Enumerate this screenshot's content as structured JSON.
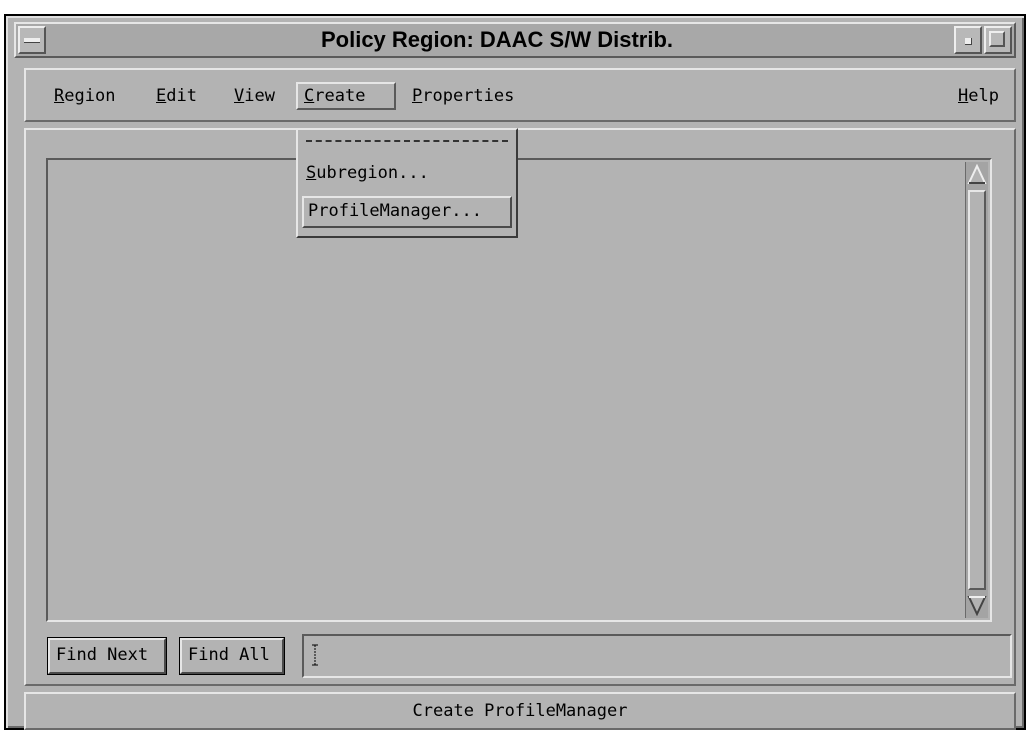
{
  "window": {
    "title": "Policy Region: DAAC S/W Distrib."
  },
  "menubar": {
    "items": [
      {
        "mnemonic": "R",
        "rest": "egion"
      },
      {
        "mnemonic": "E",
        "rest": "dit"
      },
      {
        "mnemonic": "V",
        "rest": "iew"
      },
      {
        "mnemonic": "C",
        "rest": "reate"
      },
      {
        "mnemonic": "P",
        "rest": "roperties"
      }
    ],
    "help": {
      "mnemonic": "H",
      "rest": "elp"
    }
  },
  "create_menu": {
    "items": [
      {
        "mnemonic": "S",
        "rest": "ubregion..."
      },
      {
        "mnemonic": "",
        "rest": "ProfileManager..."
      }
    ]
  },
  "find": {
    "next_label": "Find Next",
    "all_label": "Find All",
    "value": ""
  },
  "status": {
    "text": "Create ProfileManager"
  },
  "icons": {
    "window_menu": "window-menu-icon",
    "minimize": "minimize-icon",
    "maximize": "maximize-icon",
    "scroll_up": "arrow-up-icon",
    "scroll_down": "arrow-down-icon",
    "text_caret": "text-caret-icon"
  }
}
